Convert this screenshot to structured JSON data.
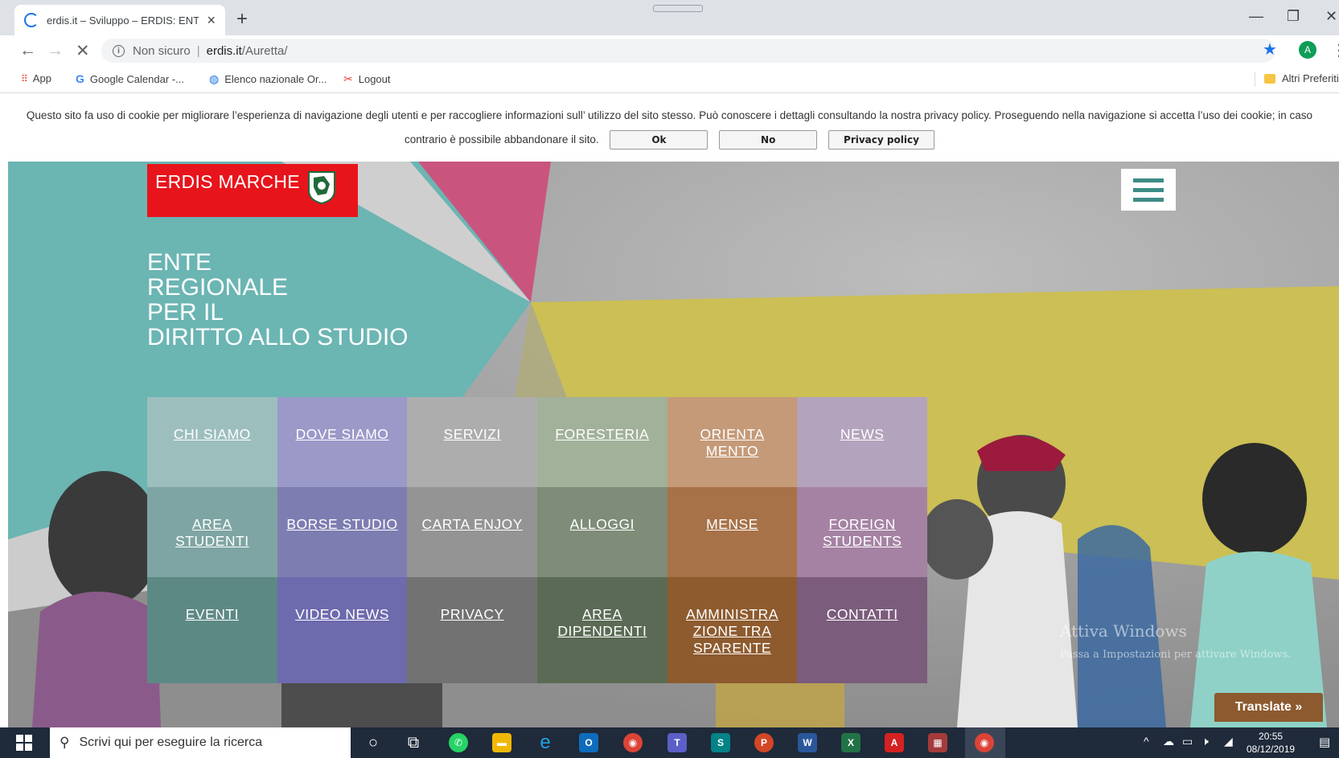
{
  "browser": {
    "tab_title": "erdis.it – Sviluppo – ERDIS: ENTE",
    "tab_close": "×",
    "new_tab": "+",
    "url_security": "Non sicuro",
    "url_separator": "|",
    "url_host": "erdis.it",
    "url_path": "/Auretta/",
    "avatar_letter": "A"
  },
  "bookmarks": {
    "items": [
      {
        "label": "App",
        "icon": "apps-icon"
      },
      {
        "label": "Google Calendar -...",
        "icon": "google-icon"
      },
      {
        "label": "Elenco nazionale Or...",
        "icon": "globe-icon"
      },
      {
        "label": "Logout",
        "icon": "logout-icon"
      }
    ],
    "other_label": "Altri Preferiti"
  },
  "cookie": {
    "text": "Questo sito fa uso di cookie per migliorare l’esperienza di navigazione degli utenti e per raccogliere informazioni sull’ utilizzo del sito stesso. Può conoscere i dettagli consultando la nostra privacy policy. Proseguendo nella navigazione si accetta l’uso dei cookie; in caso contrario è possibile abbandonare il sito.",
    "ok_label": "Ok",
    "no_label": "No",
    "privacy_label": "Privacy policy"
  },
  "site": {
    "logo_text": "ERDIS MARCHE",
    "tagline": [
      "ENTE",
      "REGIONALE",
      "PER IL",
      "DIRITTO ALLO STUDIO"
    ],
    "menu_grid": [
      {
        "label": "CHI SIAMO",
        "color": "#9cbfbd"
      },
      {
        "label": "DOVE SIAMO",
        "color": "#9b99c8"
      },
      {
        "label": "SERVIZI",
        "color": "#adadad"
      },
      {
        "label": "FORESTERIA",
        "color": "#a1b19a"
      },
      {
        "label": "ORIENTA MENTO",
        "color": "#c59a78"
      },
      {
        "label": "NEWS",
        "color": "#b4a3bd"
      },
      {
        "label": "AREA STUDENTI",
        "color": "#7ea5a3"
      },
      {
        "label": "BORSE STUDIO",
        "color": "#7e7db1"
      },
      {
        "label": "CARTA ENJOY",
        "color": "#949494"
      },
      {
        "label": "ALLOGGI",
        "color": "#7e8c78"
      },
      {
        "label": "MENSE",
        "color": "#a87248"
      },
      {
        "label": "FOREIGN STUDENTS",
        "color": "#a582a3"
      },
      {
        "label": "EVENTI",
        "color": "#5d8985"
      },
      {
        "label": "VIDEO NEWS",
        "color": "#6d6aae"
      },
      {
        "label": "PRIVACY ",
        "color": "#727272"
      },
      {
        "label": "AREA DIPENDENTI",
        "color": "#5b6a55"
      },
      {
        "label": "AMMINISTRA ZIONE TRA SPARENTE",
        "color": "#8e5b2f"
      },
      {
        "label": "CONTATTI",
        "color": "#7b5c7c"
      }
    ],
    "watermark_title": "Attiva Windows",
    "watermark_sub": "Passa a Impostazioni per attivare Windows.",
    "translate_label": "Translate »"
  },
  "taskbar": {
    "search_placeholder": "Scrivi qui per eseguire la ricerca",
    "time": "20:55",
    "date": "08/12/2019"
  },
  "colors": {
    "logo_red": "#e8141b",
    "teal": "#6bb5b3",
    "pink": "#c9557e",
    "mustard": "#cbbf55",
    "translate_brown": "#8c5a2e"
  }
}
